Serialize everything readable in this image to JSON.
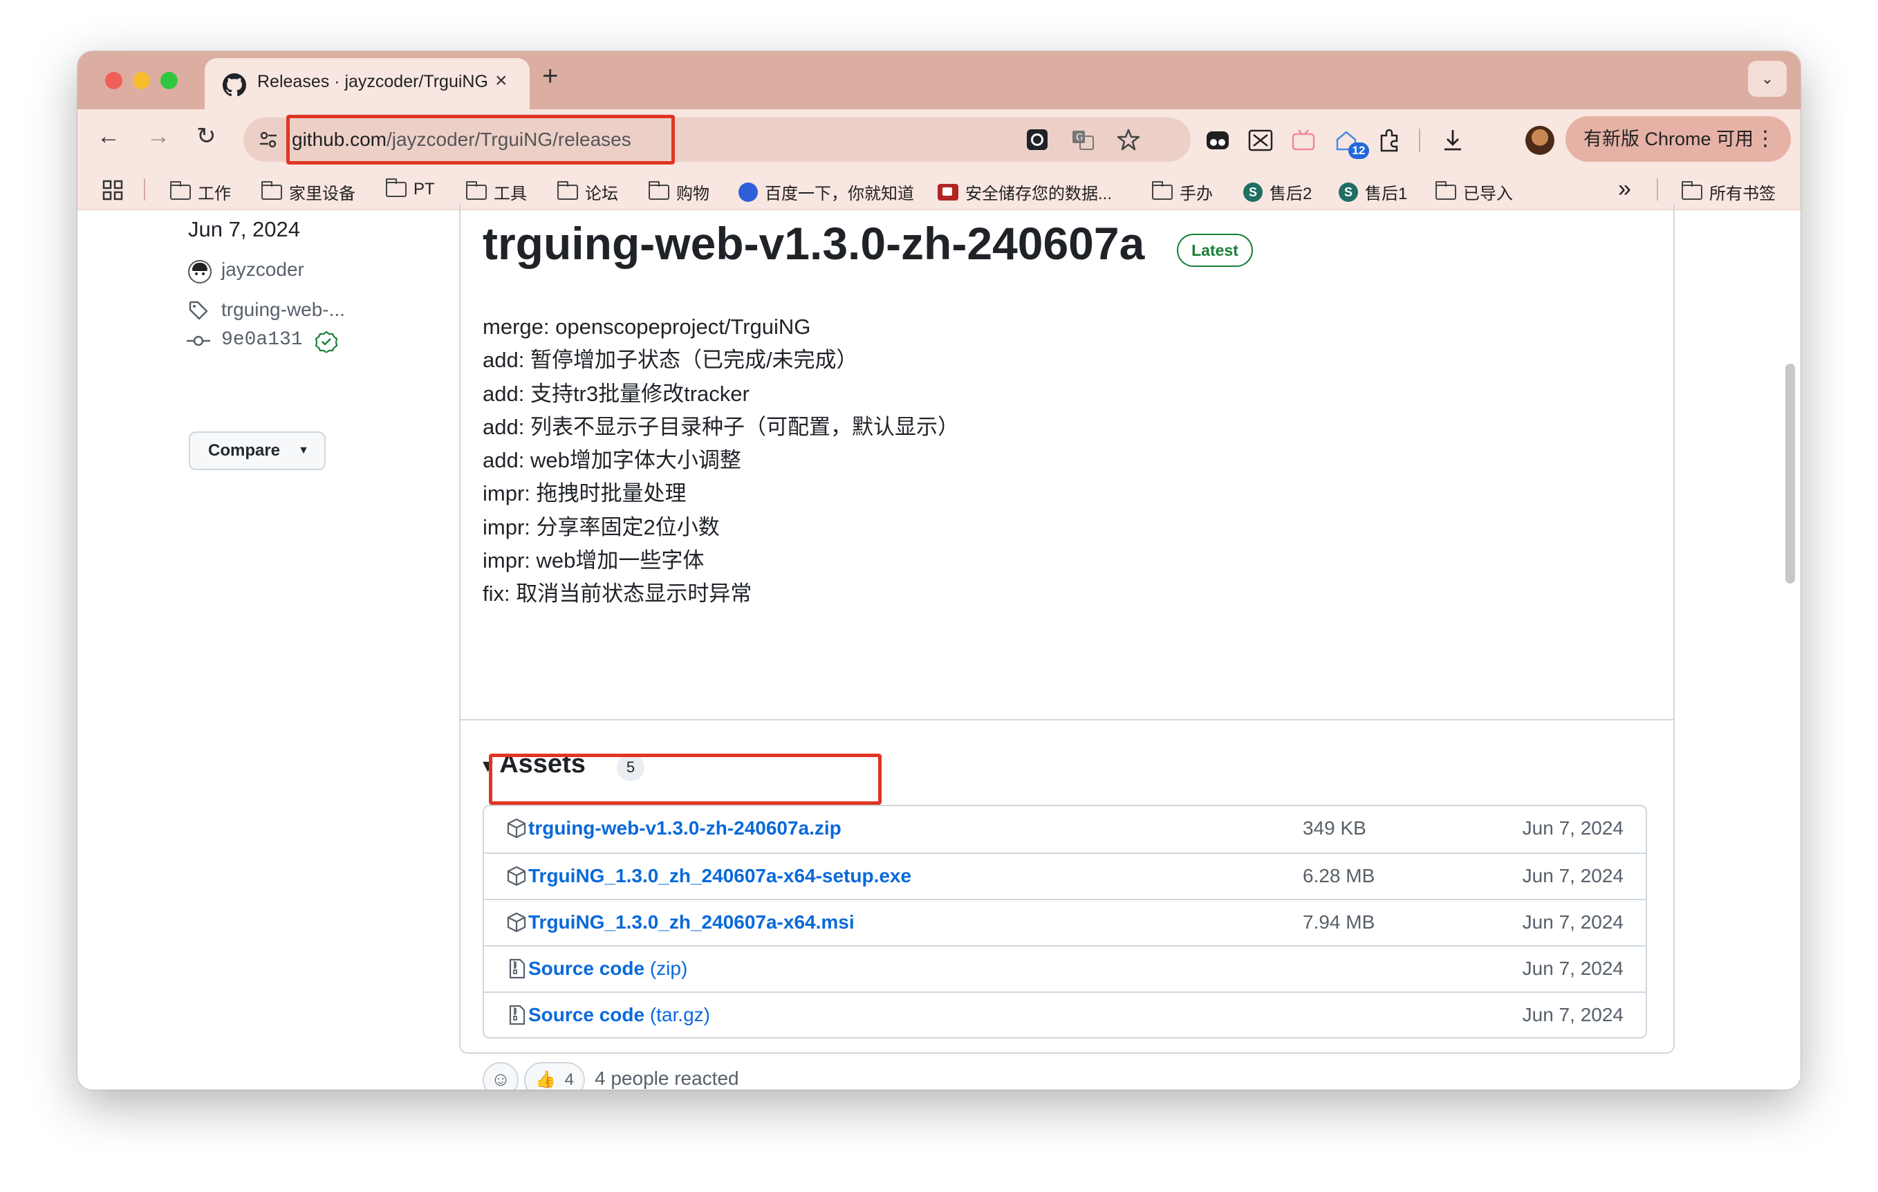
{
  "browser": {
    "tab_title": "Releases · jayzcoder/TrguiNG",
    "tab_close": "×",
    "new_tab": "+",
    "tab_menu": "⌄",
    "url_host": "github.com",
    "url_path": "/jayzcoder/TrguiNG/releases",
    "back": "←",
    "forward": "→",
    "reload": "↻",
    "update_label": "有新版 Chrome 可用",
    "update_menu": "⋮",
    "notification_count": "12"
  },
  "bookmarks": {
    "items": [
      "工作",
      "家里设备",
      "PT",
      "工具",
      "论坛",
      "购物",
      "百度一下，你就知道",
      "安全储存您的数据...",
      "手办",
      "售后2",
      "售后1",
      "已导入"
    ],
    "s_badge": "S",
    "overflow": "»",
    "all_bookmarks": "所有书签"
  },
  "sidebar": {
    "date": "Jun 7, 2024",
    "author": "jayzcoder",
    "tag": "trguing-web-...",
    "commit": "9e0a131",
    "compare_label": "Compare",
    "compare_caret": "▼"
  },
  "release": {
    "title": "trguing-web-v1.3.0-zh-240607a",
    "badge": "Latest",
    "notes": [
      "merge: openscopeproject/TrguiNG",
      "add: 暂停增加子状态（已完成/未完成）",
      "add: 支持tr3批量修改tracker",
      "add: 列表不显示子目录种子（可配置，默认显示）",
      "add: web增加字体大小调整",
      "impr: 拖拽时批量处理",
      "impr: 分享率固定2位小数",
      "impr: web增加一些字体",
      "fix: 取消当前状态显示时异常"
    ]
  },
  "assets": {
    "heading": "Assets",
    "toggle": "▾",
    "count": "5",
    "rows": [
      {
        "name": "trguing-web-v1.3.0-zh-240607a.zip",
        "suffix": "",
        "size": "349 KB",
        "date": "Jun 7, 2024",
        "icon": "package-icon"
      },
      {
        "name": "TrguiNG_1.3.0_zh_240607a-x64-setup.exe",
        "suffix": "",
        "size": "6.28 MB",
        "date": "Jun 7, 2024",
        "icon": "package-icon"
      },
      {
        "name": "TrguiNG_1.3.0_zh_240607a-x64.msi",
        "suffix": "",
        "size": "7.94 MB",
        "date": "Jun 7, 2024",
        "icon": "package-icon"
      },
      {
        "name": "Source code",
        "suffix": " (zip)",
        "size": "",
        "date": "Jun 7, 2024",
        "icon": "file-zip-icon"
      },
      {
        "name": "Source code",
        "suffix": " (tar.gz)",
        "size": "",
        "date": "Jun 7, 2024",
        "icon": "file-zip-icon"
      }
    ]
  },
  "reactions": {
    "add_emoji": "☺",
    "thumbs": "👍",
    "thumbs_count": "4",
    "summary": "4 people reacted"
  },
  "colors": {
    "tab_strip": "#dcaea2",
    "toolbar": "#f8e6e0",
    "link": "#0969da",
    "highlight": "#e03524",
    "latest": "#1a7f37"
  }
}
